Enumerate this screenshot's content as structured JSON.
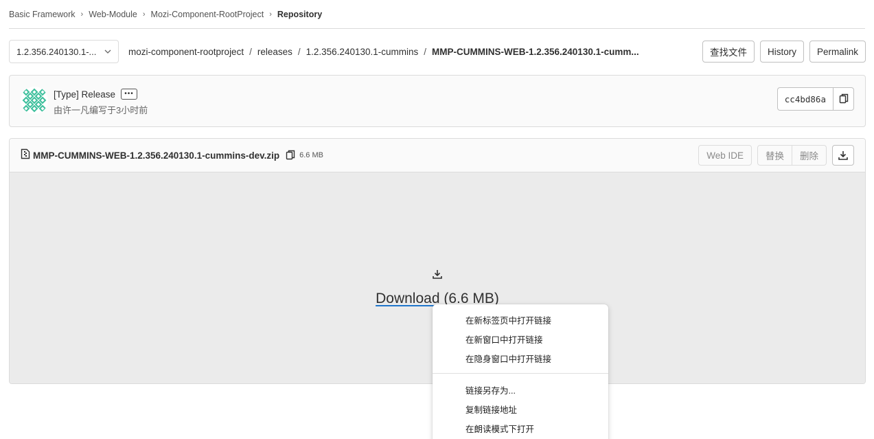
{
  "breadcrumb": {
    "items": [
      "Basic Framework",
      "Web-Module",
      "Mozi-Component-RootProject"
    ],
    "current": "Repository"
  },
  "branch": {
    "selected": "1.2.356.240130.1-..."
  },
  "path": {
    "segments": [
      "mozi-component-rootproject",
      "releases",
      "1.2.356.240130.1-cummins"
    ],
    "current": "MMP-CUMMINS-WEB-1.2.356.240130.1-cumm...",
    "separator": "/"
  },
  "tree_actions": {
    "find_file": "查找文件",
    "history": "History",
    "permalink": "Permalink"
  },
  "commit": {
    "title": "[Type] Release",
    "more": "•••",
    "meta": "由许一凡编写于3小时前",
    "sha": "cc4bd86a"
  },
  "file": {
    "name": "MMP-CUMMINS-WEB-1.2.356.240130.1-cummins-dev.zip",
    "size": "6.6 MB",
    "web_ide": "Web IDE",
    "replace": "替换",
    "delete": "删除",
    "download_label": "Download",
    "download_size": " (6.6 MB)"
  },
  "context_menu": {
    "group1": [
      "在新标签页中打开链接",
      "在新窗口中打开链接",
      "在隐身窗口中打开链接"
    ],
    "group2": [
      "链接另存为...",
      "复制链接地址",
      "在朗读模式下打开"
    ]
  },
  "icons": {
    "chevron": "chevron-down-icon",
    "copy": "copy-icon",
    "file": "file-zip-icon",
    "download": "download-icon"
  },
  "colors": {
    "link_underline": "#1f75cb",
    "avatar": "#3dbf9c"
  }
}
